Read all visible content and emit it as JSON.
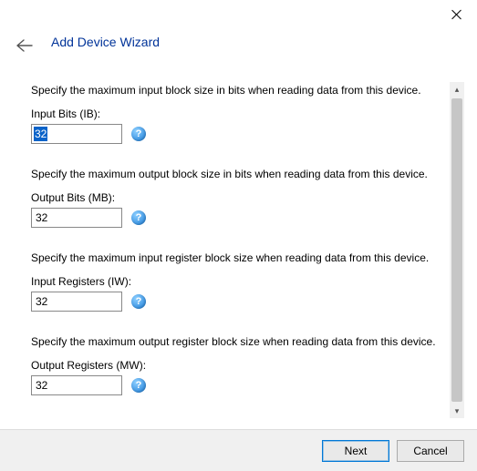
{
  "window": {
    "title": "Add Device Wizard"
  },
  "fields": {
    "input_bits": {
      "desc": "Specify the maximum input block size in bits when reading data from this device.",
      "label": "Input Bits (IB):",
      "value": "32"
    },
    "output_bits": {
      "desc": "Specify the maximum output block size in bits when reading data from this device.",
      "label": "Output Bits (MB):",
      "value": "32"
    },
    "input_registers": {
      "desc": "Specify the maximum input register block size when reading data from this device.",
      "label": "Input Registers (IW):",
      "value": "32"
    },
    "output_registers": {
      "desc": "Specify the maximum output register block size when reading data from this device.",
      "label": "Output Registers (MW):",
      "value": "32"
    }
  },
  "buttons": {
    "next": "Next",
    "cancel": "Cancel"
  },
  "icons": {
    "help_glyph": "?"
  }
}
